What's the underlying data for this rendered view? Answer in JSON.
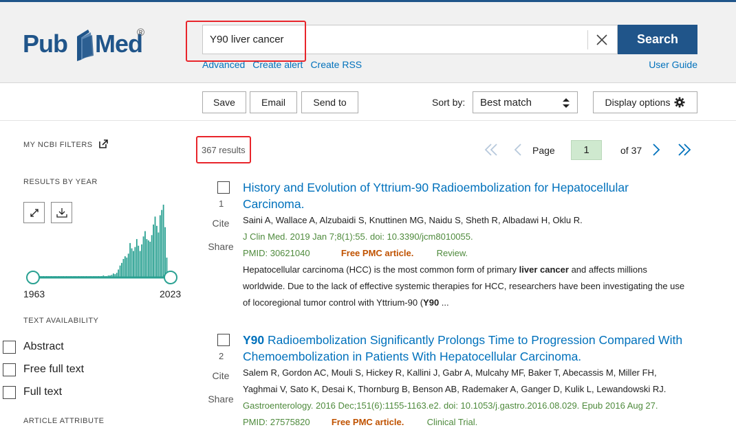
{
  "search": {
    "query": "Y90 liver cancer",
    "button_label": "Search",
    "links": [
      "Advanced",
      "Create alert",
      "Create RSS"
    ],
    "user_guide": "User Guide"
  },
  "logo": {
    "pub": "Pub",
    "med": "Med",
    "reg": "®"
  },
  "toolbar": {
    "save": "Save",
    "email": "Email",
    "send_to": "Send to",
    "sort_label": "Sort by:",
    "sort_value": "Best match",
    "display_options": "Display options"
  },
  "sidebar": {
    "my_ncbi_filters": "MY NCBI FILTERS",
    "results_by_year": "RESULTS BY YEAR",
    "year_start": "1963",
    "year_end": "2023",
    "text_availability": "TEXT AVAILABILITY",
    "filters": [
      "Abstract",
      "Free full text",
      "Full text"
    ],
    "article_attribute": "ARTICLE ATTRIBUTE"
  },
  "results": {
    "count": "367 results",
    "page_label": "Page",
    "page": "1",
    "of_pages": "of 37"
  },
  "items": [
    {
      "num": "1",
      "cite": "Cite",
      "share": "Share",
      "title_bold": "",
      "title": "History and Evolution of Yttrium-90 Radioembolization for Hepatocellular Carcinoma.",
      "authors": "Saini A, Wallace A, Alzubaidi S, Knuttinen MG, Naidu S, Sheth R, Albadawi H, Oklu R.",
      "citation": "J Clin Med. 2019 Jan 7;8(1):55. doi: 10.3390/jcm8010055.",
      "pmid": "PMID: 30621040",
      "free": "Free PMC article.",
      "type": "Review.",
      "snippet_a": "Hepatocellular carcinoma (HCC) is the most common form of primary ",
      "snippet_bold": "liver cancer",
      "snippet_b": " and affects millions worldwide. Due to the lack of effective systemic therapies for HCC, researchers have been investigating the use of locoregional tumor control with Yttrium-90 (",
      "snippet_bold2": "Y90",
      "snippet_c": " ..."
    },
    {
      "num": "2",
      "cite": "Cite",
      "share": "Share",
      "title_bold": "Y90",
      "title": " Radioembolization Significantly Prolongs Time to Progression Compared With Chemoembolization in Patients With Hepatocellular Carcinoma.",
      "authors": "Salem R, Gordon AC, Mouli S, Hickey R, Kallini J, Gabr A, Mulcahy MF, Baker T, Abecassis M, Miller FH,",
      "authors2": "Yaghmai V, Sato K, Desai K, Thornburg B, Benson AB, Rademaker A, Ganger D, Kulik L, Lewandowski RJ.",
      "citation": "Gastroenterology. 2016 Dec;151(6):1155-1163.e2. doi: 10.1053/j.gastro.2016.08.029. Epub 2016 Aug 27.",
      "pmid": "PMID: 27575820",
      "free": "Free PMC article.",
      "type": "Clinical Trial."
    }
  ],
  "timeline_counts": [
    1,
    0,
    0,
    1,
    0,
    0,
    0,
    1,
    0,
    0,
    1,
    1,
    0,
    1,
    1,
    1,
    0,
    1,
    1,
    1,
    1,
    1,
    1,
    1,
    1,
    2,
    1,
    1,
    2,
    1,
    2,
    1,
    2,
    2,
    1,
    2,
    2,
    1,
    1,
    2,
    2,
    3,
    2,
    2,
    3,
    3,
    4,
    6,
    5,
    7,
    12,
    18,
    22,
    28,
    32,
    30,
    36,
    52,
    44,
    40,
    46,
    58,
    48,
    40,
    50,
    62,
    70,
    58,
    56,
    54,
    64,
    80,
    92,
    78,
    68,
    94,
    102,
    110,
    76,
    30
  ],
  "colors": {
    "brand": "#20558a",
    "link": "#0071bc",
    "green": "#4e8a3c",
    "orange": "#c05200",
    "highlight": "#e8242a",
    "chart": "#2aa192"
  }
}
